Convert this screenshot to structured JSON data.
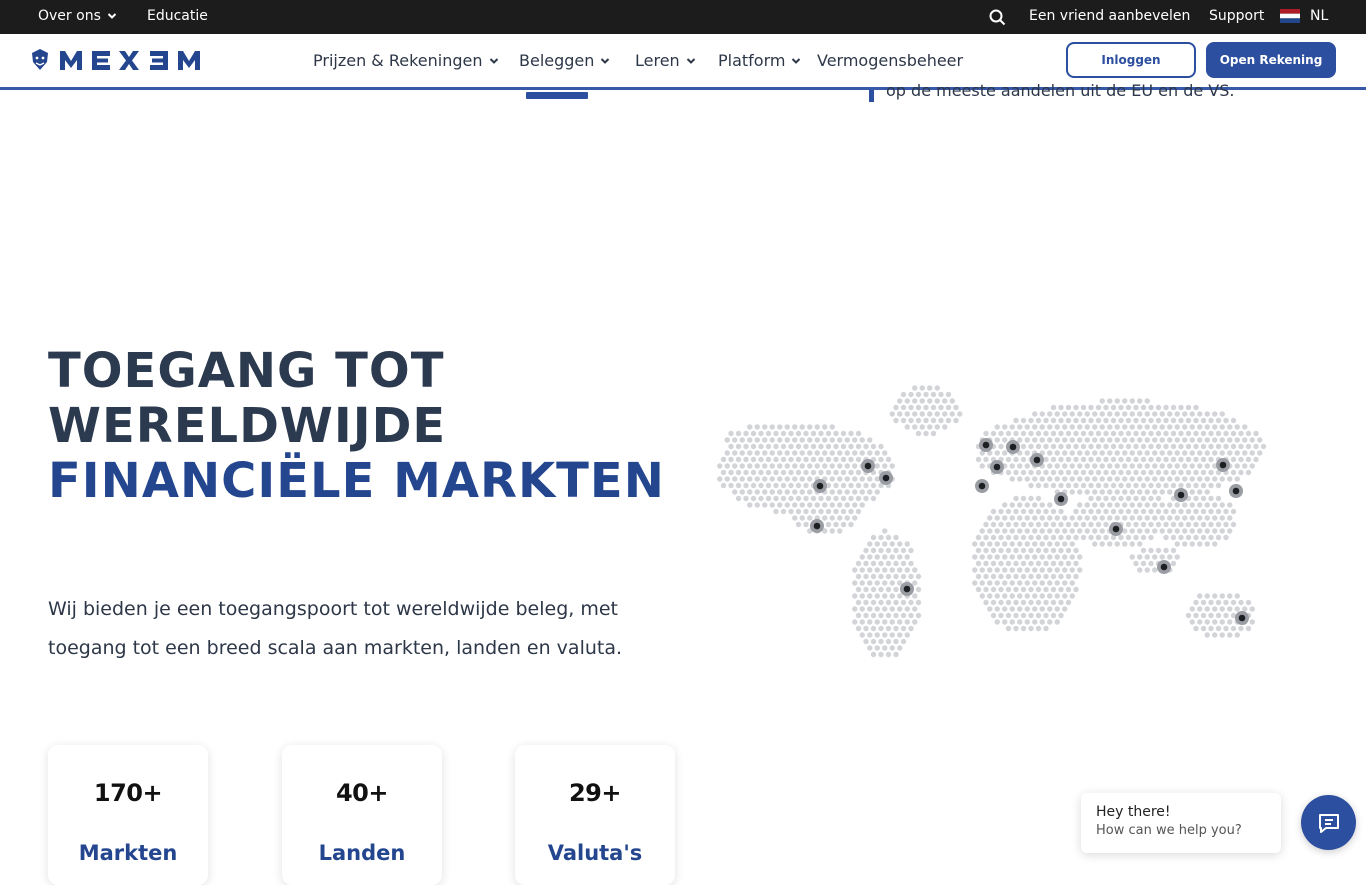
{
  "topbar": {
    "about_label": "Over ons",
    "education_label": "Educatie",
    "refer_label": "Een vriend aanbevelen",
    "support_label": "Support",
    "language_label": "NL"
  },
  "nav": {
    "brand": "MEXEM",
    "items": [
      {
        "label": "Prijzen & Rekeningen"
      },
      {
        "label": "Beleggen"
      },
      {
        "label": "Leren"
      },
      {
        "label": "Platform"
      },
      {
        "label": "Vermogensbeheer"
      }
    ],
    "login_label": "Inloggen",
    "open_account_label": "Open Rekening"
  },
  "previous_section": {
    "quote_text": "op de meeste aandelen uit de EU en de VS."
  },
  "hero": {
    "title_line1": "TOEGANG TOT",
    "title_line2": "WERELDWIJDE",
    "title_line3": "FINANCIËLE MARKTEN",
    "description": "Wij bieden je een toegangspoort tot wereldwijde beleg, met toegang tot een breed scala aan markten, landen en valuta."
  },
  "stats": [
    {
      "value": "170+",
      "label": "Markten"
    },
    {
      "value": "40+",
      "label": "Landen"
    },
    {
      "value": "29+",
      "label": "Valuta's"
    }
  ],
  "chat": {
    "greeting": "Hey there!",
    "prompt": "How can we help you?"
  },
  "colors": {
    "brand_blue": "#23468f",
    "button_blue": "#2d4f9f",
    "topbar_bg": "#1c1c1c",
    "heading_dark": "#2b3a4f",
    "map_dot": "#d2d4d8"
  },
  "icons": [
    "chevron-down-icon",
    "search-icon",
    "nl-flag-icon",
    "lion-logo-icon",
    "world-map",
    "chat-icon"
  ]
}
